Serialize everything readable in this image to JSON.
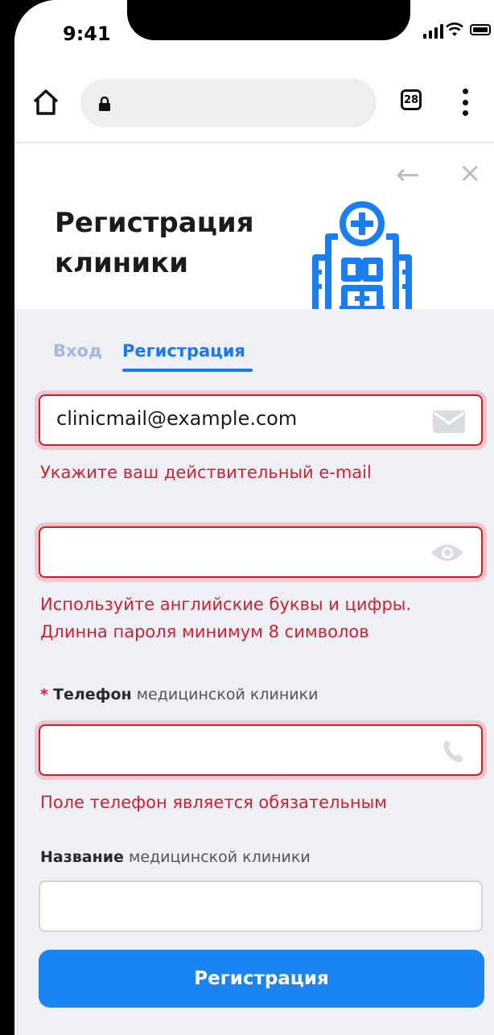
{
  "status_bar": {
    "time": "9:41"
  },
  "browser": {
    "tab_count": "28"
  },
  "header": {
    "title_line1": "Регистрация",
    "title_line2": "клиники"
  },
  "tabs": {
    "login": "Вход",
    "register": "Регистрация"
  },
  "email": {
    "value": "clinicmail@example.com",
    "error": "Укажите ваш действительный e-mail"
  },
  "password": {
    "value": "",
    "error_line1": "Используйте английские буквы и цифры.",
    "error_line2": "Длинна пароля минимум 8 символов"
  },
  "phone": {
    "required_mark": "*",
    "label_bold": "Телефон",
    "label_rest": "медицинской клиники",
    "value": "",
    "error": "Поле телефон является обязательным"
  },
  "clinic_name": {
    "label_bold": "Название",
    "label_rest": "медицинской клиники",
    "value": ""
  },
  "submit": {
    "label": "Регистрация"
  },
  "colors": {
    "accent": "#1a78e8",
    "error": "#d0202f",
    "button": "#1a84f3"
  }
}
